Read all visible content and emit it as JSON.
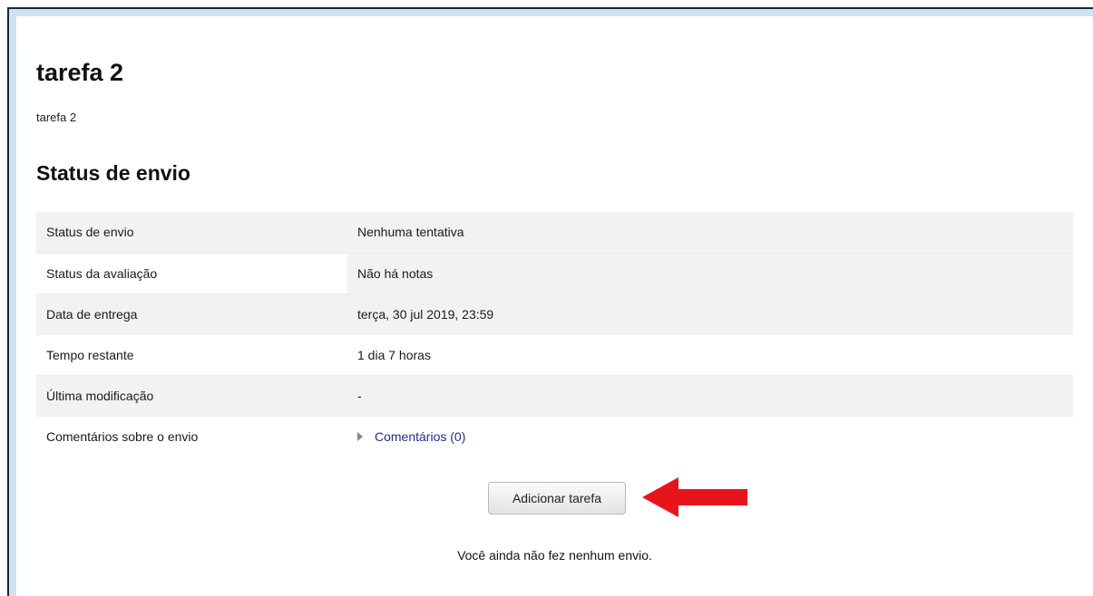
{
  "assignment": {
    "title": "tarefa 2",
    "intro": "tarefa 2"
  },
  "submission_status": {
    "heading": "Status de envio",
    "rows": [
      {
        "label": "Status de envio",
        "value": "Nenhuma tentativa"
      },
      {
        "label": "Status da avaliação",
        "value": "Não há notas"
      },
      {
        "label": "Data de entrega",
        "value": "terça, 30 jul 2019, 23:59"
      },
      {
        "label": "Tempo restante",
        "value": "1 dia 7 horas"
      },
      {
        "label": "Última modificação",
        "value": "-"
      },
      {
        "label": "Comentários sobre o envio",
        "value": "Comentários (0)"
      }
    ]
  },
  "actions": {
    "add_submission_label": "Adicionar tarefa",
    "no_submission_text": "Você ainda não fez nenhum envio."
  },
  "colors": {
    "annotation_arrow": "#e8141c",
    "link": "#1d2f8f",
    "frame_accent": "#cfe3f1"
  },
  "icons": {
    "expand": "caret-right-icon",
    "annotation": "red-arrow-left-icon"
  }
}
